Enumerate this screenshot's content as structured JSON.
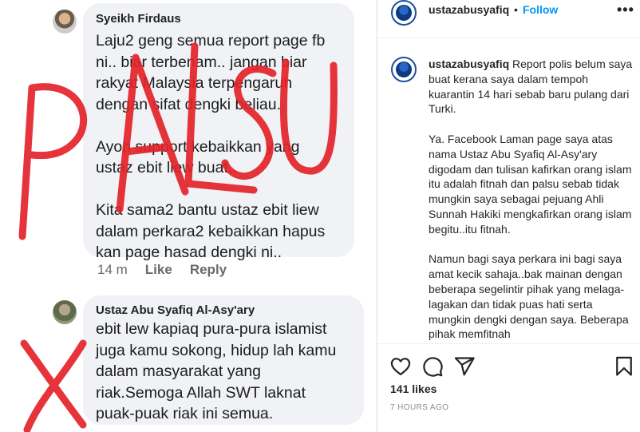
{
  "photo": {
    "comments": [
      {
        "name": "Syeikh Firdaus",
        "text": "Laju2 geng semua report page fb\nni.. biar terbenam.. jangan biar\nrakyat Malaysia terpengaruh\ndengan sifat dengki beliau..\n\nAyoh support kebaikkan yang\nustaz ebit liew buat..\n\nKita sama2 bantu ustaz ebit liew\ndalam perkara2 kebaikkan hapus\nkan page hasad dengki ni..",
        "time": "14 m",
        "like": "Like",
        "reply": "Reply"
      },
      {
        "name": "Ustaz Abu Syafiq Al-Asy'ary",
        "text": "ebit lew kapiaq pura-pura islamist\njuga kamu sokong, hidup lah kamu\ndalam masyarakat yang\nriak.Semoga Allah SWT laknat\npuak-puak riak ini semua."
      }
    ],
    "stamp": "PALSU",
    "overlay_color": "#e3232a"
  },
  "instagram": {
    "username": "ustazabusyafiq",
    "dot": "•",
    "follow": "Follow",
    "more": "•••",
    "caption_user": "ustazabusyafiq",
    "caption_paragraphs": [
      "Report polis belum saya buat kerana saya dalam tempoh kuarantin 14 hari sebab baru pulang dari Turki.",
      "Ya. Facebook Laman page saya atas nama Ustaz Abu Syafiq Al-Asy'ary digodam dan tulisan kafirkan orang islam itu adalah fitnah dan palsu sebab tidak mungkin saya sebagai pejuang Ahli Sunnah Hakiki mengkafirkan orang islam begitu..itu fitnah.",
      "Namun bagi saya perkara ini bagi saya amat kecik sahaja..bak mainan dengan beberapa segelintir pihak yang melaga-lagakan dan tidak puas hati serta mungkin dengki dengan saya. Beberapa pihak memfitnah"
    ],
    "likes": "141 likes",
    "time_ago": "7 HOURS AGO",
    "icons": [
      "heart-icon",
      "comment-icon",
      "share-icon",
      "bookmark-icon"
    ],
    "follow_color": "#0095f6"
  }
}
